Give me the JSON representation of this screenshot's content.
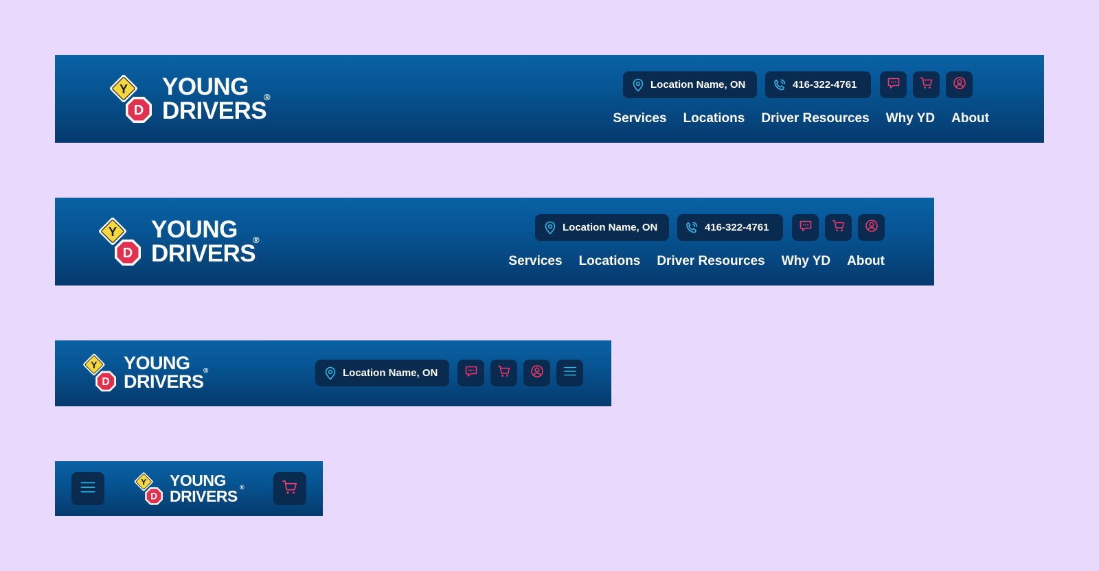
{
  "brand": {
    "line1": "YOUNG",
    "line2": "DRIVERS",
    "reg": "®",
    "badge_top": "Y",
    "badge_bottom": "D"
  },
  "location": {
    "label": "Location Name, ON"
  },
  "phone": {
    "label": "416-322-4761"
  },
  "nav": {
    "items": [
      "Services",
      "Locations",
      "Driver Resources",
      "Why YD",
      "About"
    ]
  },
  "icons": {
    "location": "map-pin-icon",
    "phone": "phone-icon",
    "chat": "chat-icon",
    "cart": "cart-icon",
    "account": "user-icon",
    "menu": "hamburger-menu-icon"
  },
  "colors": {
    "page_bg": "#e8d9fd",
    "header_top": "#0a62a6",
    "header_bottom": "#053a6d",
    "pill_bg": "#082b4f",
    "icon_cyan": "#2fb8e6",
    "icon_pink": "#f0386b",
    "badge_yellow": "#f5d93c",
    "badge_red": "#e4304f"
  }
}
